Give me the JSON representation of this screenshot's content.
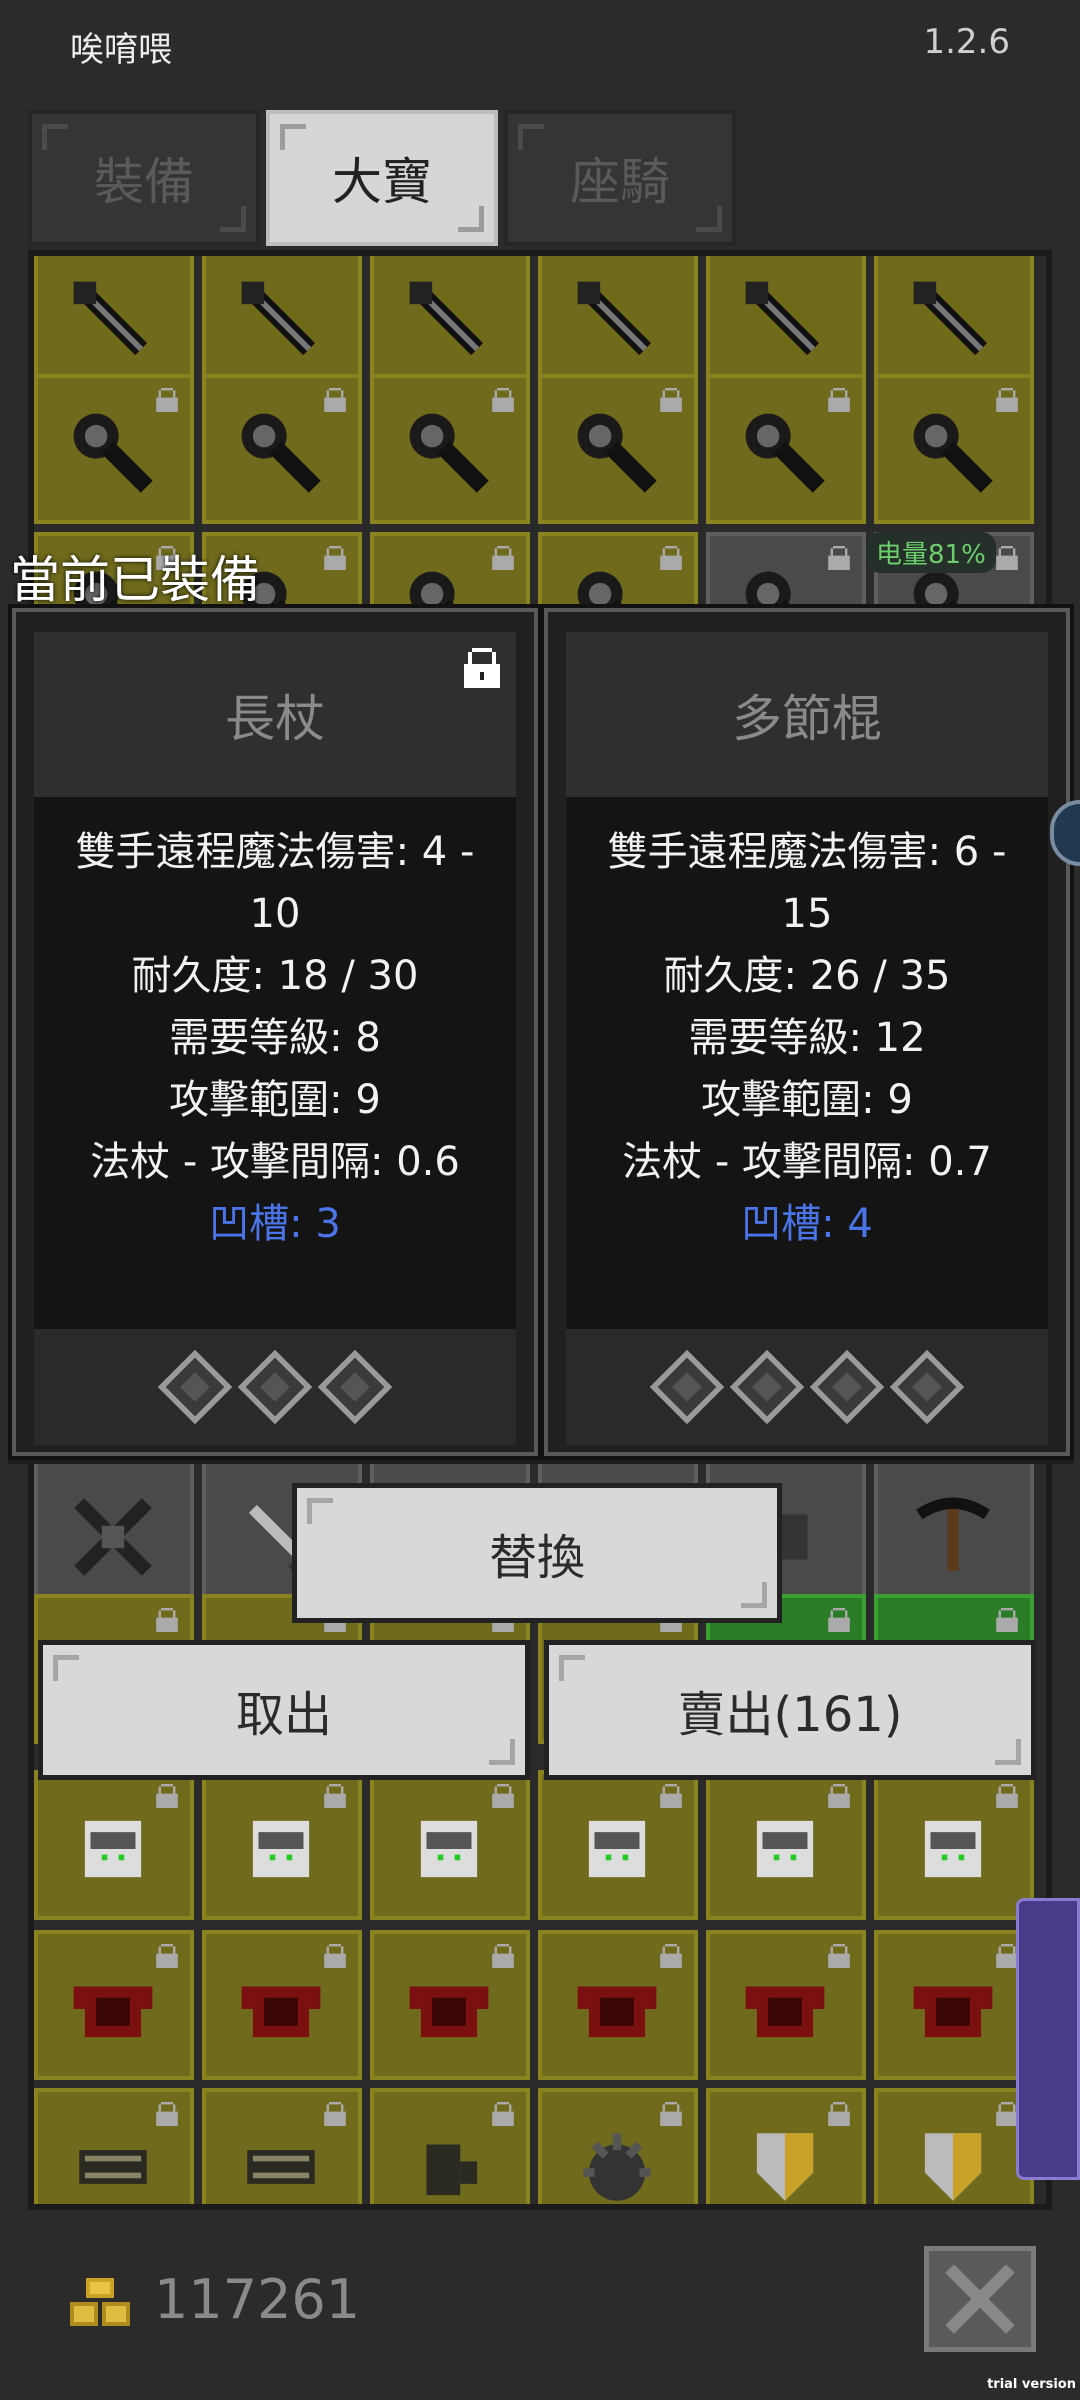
{
  "header": {
    "app_title": "唉唷喂",
    "version": "1.2.6"
  },
  "tabs": [
    {
      "label": "裝備",
      "active": false
    },
    {
      "label": "大寶",
      "active": true
    },
    {
      "label": "座騎",
      "active": false
    }
  ],
  "status": {
    "battery": "电量81%"
  },
  "equipped_label": "當前已裝備",
  "cards": [
    {
      "name": "長杖",
      "locked": true,
      "stats": [
        "雙手遠程魔法傷害: 4 -",
        "10",
        "耐久度: 18 / 30",
        "需要等級: 8",
        "攻擊範圍: 9",
        "法杖 - 攻擊間隔: 0.6"
      ],
      "socket_text": "凹槽: 3",
      "sockets": 3
    },
    {
      "name": "多節棍",
      "locked": false,
      "stats": [
        "雙手遠程魔法傷害: 6 -",
        "15",
        "耐久度: 26 / 35",
        "需要等級: 12",
        "攻擊範圍: 9",
        "法杖 - 攻擊間隔: 0.7"
      ],
      "socket_text": "凹槽: 4",
      "sockets": 4
    }
  ],
  "buttons": {
    "replace": "替換",
    "take_out": "取出",
    "sell": "賣出(161)"
  },
  "footer": {
    "gold": "117261"
  },
  "watermark": "trial version",
  "colors": {
    "cell_yellow": "#6f6a1c",
    "socket_text": "#4a74e8",
    "battery_text": "#6ccf6c"
  },
  "icons": [
    "staff-icon",
    "mace-icon",
    "lock-icon",
    "gem-socket-icon",
    "gold-coins-icon",
    "close-icon",
    "crossbow-icon",
    "sword-icon",
    "scroll-icon",
    "helmet-icon",
    "armor-icon",
    "bracers-icon",
    "shield-icon",
    "gloves-icon",
    "spiked-helmet-icon"
  ]
}
